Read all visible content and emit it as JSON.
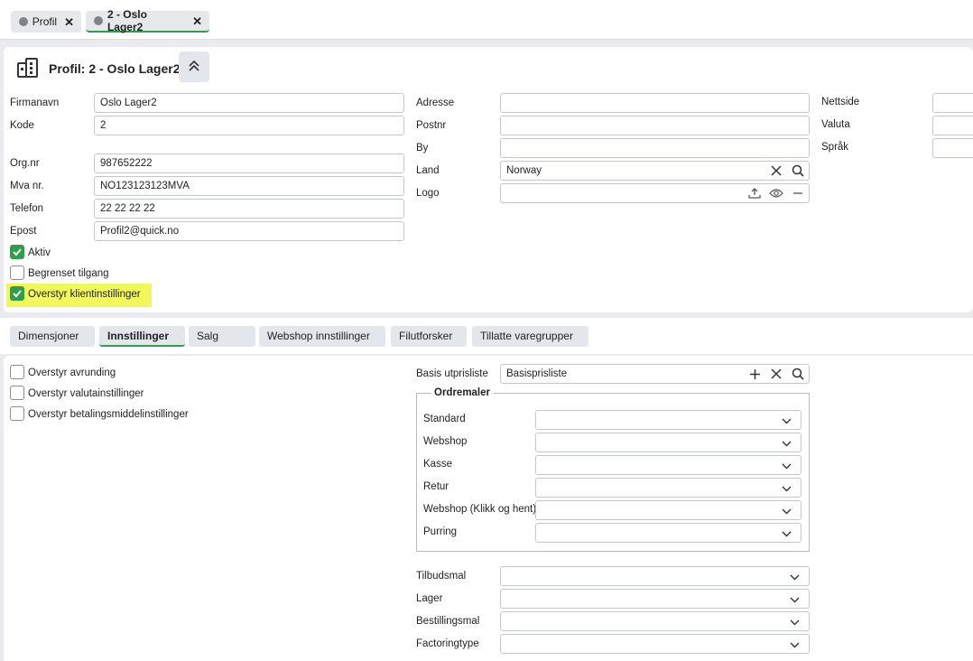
{
  "tabs": [
    {
      "label": "Profil",
      "close": "✕"
    },
    {
      "label": "2 - Oslo Lager2",
      "close": "✕"
    }
  ],
  "header": {
    "title": "Profil: 2 - Oslo Lager2"
  },
  "form": {
    "firmanavn": {
      "label": "Firmanavn",
      "value": "Oslo Lager2"
    },
    "kode": {
      "label": "Kode",
      "value": "2"
    },
    "orgnr": {
      "label": "Org.nr",
      "value": "987652222"
    },
    "mva": {
      "label": "Mva nr.",
      "value": "NO123123123MVA"
    },
    "telefon": {
      "label": "Telefon",
      "value": "22 22 22 22"
    },
    "epost": {
      "label": "Epost",
      "value": "Profil2@quick.no"
    },
    "adresse": {
      "label": "Adresse",
      "value": ""
    },
    "postnr": {
      "label": "Postnr",
      "value": ""
    },
    "by": {
      "label": "By",
      "value": ""
    },
    "land": {
      "label": "Land",
      "value": "Norway"
    },
    "logo": {
      "label": "Logo",
      "value": ""
    },
    "nettside": {
      "label": "Nettside",
      "value": ""
    },
    "valuta": {
      "label": "Valuta",
      "value": ""
    },
    "sprak": {
      "label": "Språk",
      "value": ""
    }
  },
  "checkboxes": {
    "aktiv": {
      "label": "Aktiv",
      "checked": true
    },
    "begrenset": {
      "label": "Begrenset tilgang",
      "checked": false
    },
    "overstyr_klient": {
      "label": "Overstyr klientinstillinger",
      "checked": true
    }
  },
  "subtabs": [
    "Dimensjoner",
    "Innstillinger",
    "Salg",
    "Webshop innstillinger",
    "Filutforsker",
    "Tillatte varegrupper"
  ],
  "settings": {
    "checks": [
      "Overstyr avrunding",
      "Overstyr valutainstillinger",
      "Overstyr betalingsmiddelinstillinger"
    ],
    "basis": {
      "label": "Basis utprisliste",
      "value": "Basisprisliste"
    },
    "ordremaler": {
      "legend": "Ordremaler",
      "rows": [
        "Standard",
        "Webshop",
        "Kasse",
        "Retur",
        "Webshop (Klikk og hent)",
        "Purring"
      ]
    },
    "lower": [
      "Tilbudsmal",
      "Lager",
      "Bestillingsmal",
      "Factoringtype"
    ]
  },
  "colors": {
    "accent": "#2e9e4a",
    "highlight": "#f3f85a",
    "page_bg": "#e9ebee"
  }
}
